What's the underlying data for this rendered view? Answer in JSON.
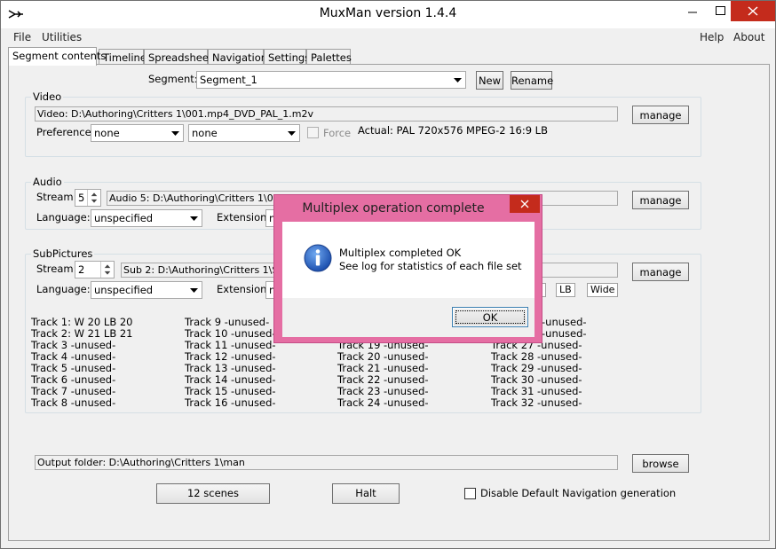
{
  "window": {
    "title": "MuxMan version 1.4.4"
  },
  "menu": {
    "file": "File",
    "utilities": "Utilities",
    "help": "Help",
    "about": "About"
  },
  "tabs": [
    "Segment contents",
    "Timeline",
    "Spreadsheet",
    "Navigation",
    "Settings",
    "Palettes"
  ],
  "segment": {
    "label": "Segment:",
    "value": "Segment_1",
    "new_label": "New",
    "rename_label": "Rename"
  },
  "video": {
    "legend": "Video",
    "file": "Video: D:\\Authoring\\Critters 1\\001.mp4_DVD_PAL_1.m2v",
    "manage": "manage",
    "preference_label": "Preference:",
    "pref1": "none",
    "pref2": "none",
    "force_label": "Force",
    "actual": "Actual: PAL  720x576  MPEG-2  16:9 LB"
  },
  "audio": {
    "legend": "Audio",
    "stream_label": "Stream:",
    "stream_value": "5",
    "file": "Audio 5: D:\\Authoring\\Critters 1\\01002.",
    "manage": "manage",
    "language_label": "Language:",
    "language_value": "unspecified",
    "extension_label": "Extension:",
    "extension_value": "n"
  },
  "subpictures": {
    "legend": "SubPictures",
    "stream_label": "Stream:",
    "stream_value": "2",
    "file": "Sub 2: D:\\Authoring\\Critters 1\\Subp",
    "manage": "manage",
    "language_label": "Language:",
    "language_value": "unspecified",
    "extension_label": "Extension:",
    "extension_value": "n",
    "lb_label": "LB",
    "wide_label": "Wide",
    "tracks": {
      "col1": [
        "Track 1:  W 20  LB 20",
        "Track 2:  W 21  LB 21",
        "Track 3  -unused-",
        "Track 4  -unused-",
        "Track 5  -unused-",
        "Track 6  -unused-",
        "Track 7  -unused-",
        "Track 8  -unused-"
      ],
      "col2": [
        "Track 9  -unused-",
        "Track 10  -unused-",
        "Track 11  -unused-",
        "Track 12  -unused-",
        "Track 13  -unused-",
        "Track 14  -unused-",
        "Track 15  -unused-",
        "Track 16  -unused-"
      ],
      "col3": [
        "",
        "",
        "Track 19  -unused-",
        "Track 20  -unused-",
        "Track 21  -unused-",
        "Track 22  -unused-",
        "Track 23  -unused-",
        "Track 24  -unused-"
      ],
      "col4": [
        "-unused-",
        "-unused-",
        "Track 27  -unused-",
        "Track 28  -unused-",
        "Track 29  -unused-",
        "Track 30  -unused-",
        "Track 31  -unused-",
        "Track 32  -unused-"
      ]
    }
  },
  "output": {
    "folder": "Output folder: D:\\Authoring\\Critters 1\\man",
    "browse": "browse"
  },
  "footer": {
    "scenes": "12 scenes",
    "halt": "Halt",
    "disable_nav": "Disable Default Navigation generation"
  },
  "dialog": {
    "title": "Multiplex operation complete",
    "line1": "Multiplex completed OK",
    "line2": "See log for statistics of each file set",
    "ok": "OK"
  }
}
